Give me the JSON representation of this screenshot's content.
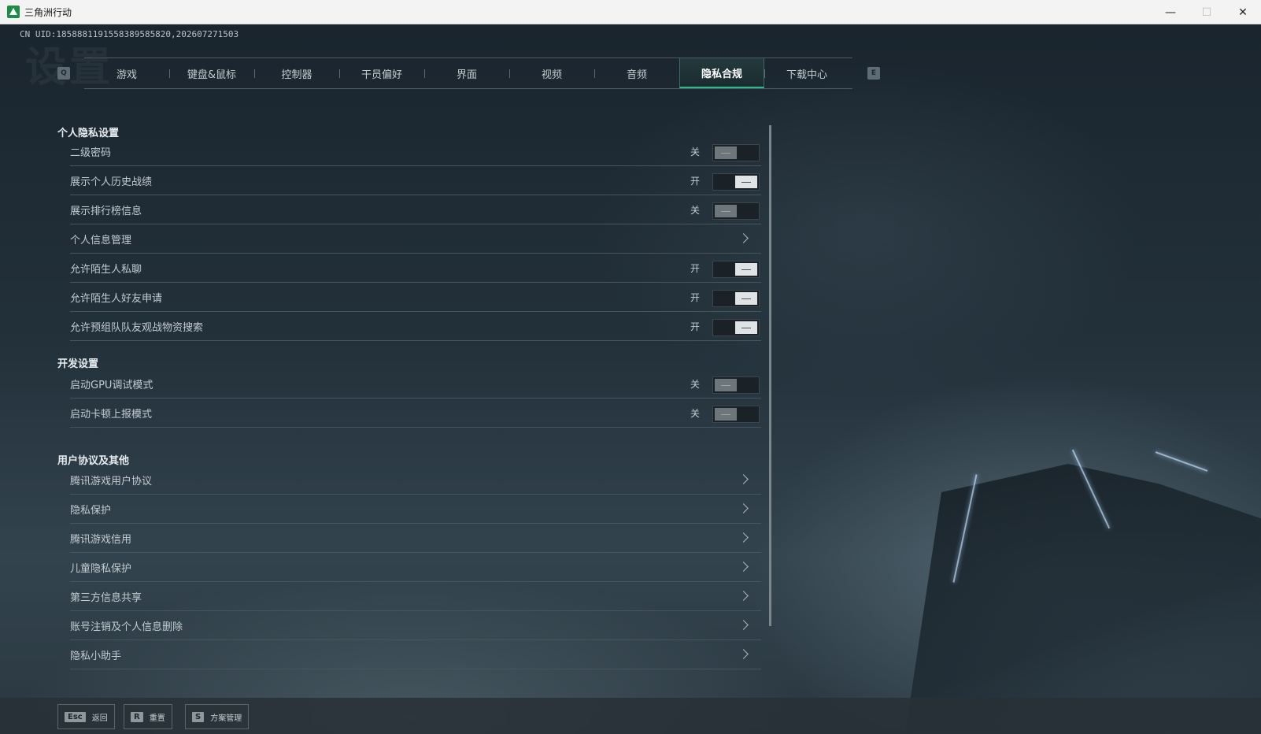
{
  "window": {
    "title": "三角洲行动",
    "minimize": "—",
    "maximize": "☐",
    "close": "✕"
  },
  "uid": "CN UID:1858881191558389585820,202607271503",
  "watermark": "设置",
  "tabs": [
    {
      "label": "游戏",
      "active": false
    },
    {
      "label": "键盘&鼠标",
      "active": false
    },
    {
      "label": "控制器",
      "active": false
    },
    {
      "label": "干员偏好",
      "active": false
    },
    {
      "label": "界面",
      "active": false
    },
    {
      "label": "视频",
      "active": false
    },
    {
      "label": "音频",
      "active": false
    },
    {
      "label": "隐私合规",
      "active": true
    },
    {
      "label": "下载中心",
      "active": false
    }
  ],
  "tab_keys": {
    "prev": "Q",
    "next": "E"
  },
  "sections": {
    "privacy": {
      "title": "个人隐私设置",
      "items": [
        {
          "label": "二级密码",
          "type": "toggle",
          "state": "关",
          "on": false
        },
        {
          "label": "展示个人历史战绩",
          "type": "toggle",
          "state": "开",
          "on": true
        },
        {
          "label": "展示排行榜信息",
          "type": "toggle",
          "state": "关",
          "on": false
        },
        {
          "label": "个人信息管理",
          "type": "link"
        },
        {
          "label": "允许陌生人私聊",
          "type": "toggle",
          "state": "开",
          "on": true
        },
        {
          "label": "允许陌生人好友申请",
          "type": "toggle",
          "state": "开",
          "on": true
        },
        {
          "label": "允许预组队队友观战物资搜索",
          "type": "toggle",
          "state": "开",
          "on": true
        }
      ]
    },
    "dev": {
      "title": "开发设置",
      "items": [
        {
          "label": "启动GPU调试模式",
          "type": "toggle",
          "state": "关",
          "on": false
        },
        {
          "label": "启动卡顿上报模式",
          "type": "toggle",
          "state": "关",
          "on": false
        }
      ]
    },
    "agreements": {
      "title": "用户协议及其他",
      "items": [
        {
          "label": "腾讯游戏用户协议",
          "type": "link"
        },
        {
          "label": "隐私保护",
          "type": "link"
        },
        {
          "label": "腾讯游戏信用",
          "type": "link"
        },
        {
          "label": "儿童隐私保护",
          "type": "link"
        },
        {
          "label": "第三方信息共享",
          "type": "link"
        },
        {
          "label": "账号注销及个人信息删除",
          "type": "link"
        },
        {
          "label": "隐私小助手",
          "type": "link"
        }
      ]
    }
  },
  "footer": [
    {
      "key": "Esc",
      "label": "返回"
    },
    {
      "key": "R",
      "label": "重置"
    },
    {
      "key": "S",
      "label": "方案管理"
    }
  ]
}
